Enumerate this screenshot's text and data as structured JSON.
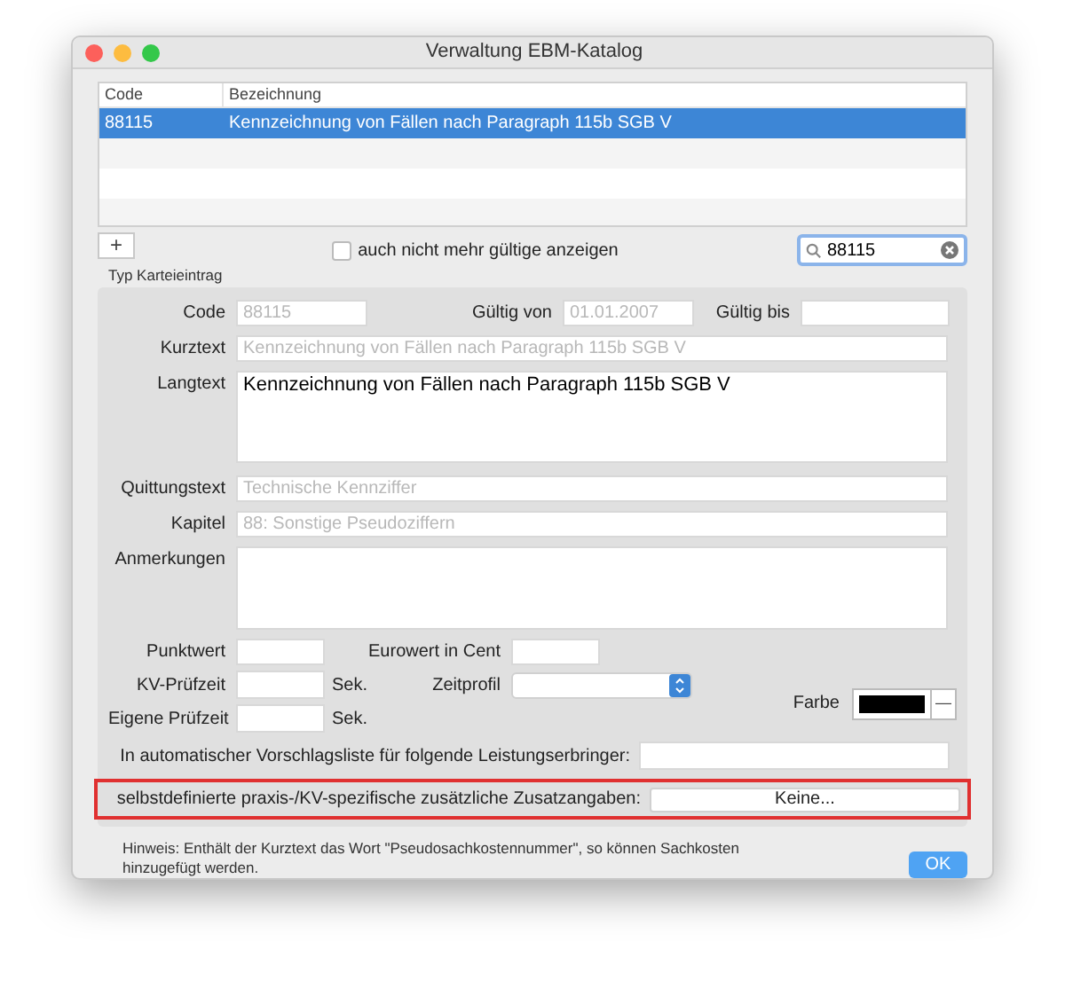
{
  "window": {
    "title": "Verwaltung EBM-Katalog"
  },
  "table": {
    "columns": [
      "Code",
      "Bezeichnung"
    ],
    "rows": [
      {
        "cells": [
          "88115",
          "Kennzeichnung von Fällen nach Paragraph 115b SGB V"
        ],
        "selected": true
      }
    ]
  },
  "add_button": {
    "label": "+"
  },
  "show_invalid": {
    "label": "auch nicht mehr gültige anzeigen",
    "checked": false
  },
  "search": {
    "value": "88115"
  },
  "section": {
    "title": "Typ Karteieintrag"
  },
  "code": {
    "label": "Code",
    "value": "88115",
    "disabled": true
  },
  "valid_from": {
    "label": "Gültig von",
    "value": "01.01.2007",
    "disabled": true
  },
  "valid_to": {
    "label": "Gültig bis"
  },
  "kurztext": {
    "label": "Kurztext",
    "value": "Kennzeichnung von Fällen nach Paragraph 115b SGB V",
    "disabled": true
  },
  "langtext": {
    "label": "Langtext",
    "value": "Kennzeichnung von Fällen nach Paragraph 115b SGB V",
    "disabled": false
  },
  "quittungstext": {
    "label": "Quittungstext",
    "value": "Technische Kennziffer",
    "disabled": true
  },
  "kapitel": {
    "label": "Kapitel",
    "value": "88: Sonstige Pseudoziffern",
    "disabled": true
  },
  "anmerkungen": {
    "label": "Anmerkungen"
  },
  "punktwert": {
    "label": "Punktwert"
  },
  "eurowert": {
    "label": "Eurowert in Cent"
  },
  "kv_pruefzeit": {
    "label": "KV-Prüfzeit",
    "unit": "Sek."
  },
  "zeitprofil": {
    "label": "Zeitprofil"
  },
  "eigene_pruefzeit": {
    "label": "Eigene Prüfzeit",
    "unit": "Sek."
  },
  "farbe": {
    "label": "Farbe",
    "color": "#000000",
    "clear": "—"
  },
  "vorschlagsliste": {
    "label": "In automatischer Vorschlagsliste für folgende Leistungserbringer:"
  },
  "zusatzangaben": {
    "label": "selbstdefinierte praxis-/KV-spezifische zusätzliche Zusatzangaben:",
    "button": "Keine...",
    "highlighted": true
  },
  "hint": "Hinweis: Enthält der Kurztext das Wort \"Pseudosachkostennummer\", so können Sachkosten hinzugefügt werden.",
  "ok_button": {
    "label": "OK"
  }
}
